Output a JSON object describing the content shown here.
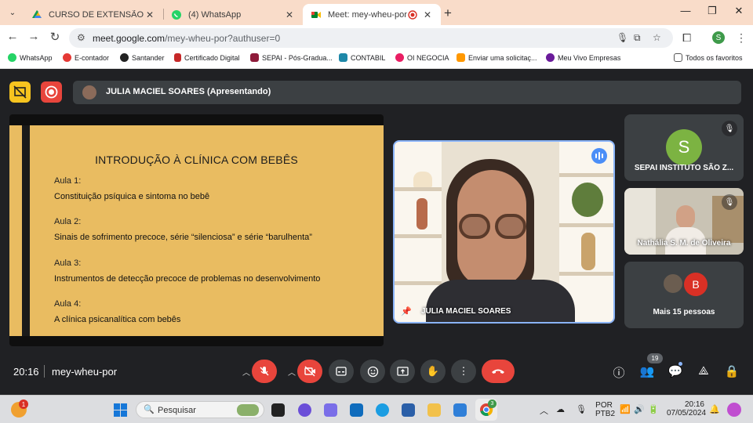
{
  "browser": {
    "tabs": [
      {
        "title": "CURSO DE EXTENSÃO INTRODU",
        "active": false
      },
      {
        "title": "(4) WhatsApp",
        "active": false
      },
      {
        "title": "Meet: mey-wheu-por",
        "active": true
      }
    ],
    "url_host": "meet.google.com",
    "url_path": "/mey-wheu-por?authuser=0",
    "profile_initial": "S",
    "bookmarks": [
      "WhatsApp",
      "E-contador",
      "Santander",
      "Certificado Digital",
      "SEPAI - Pós-Gradua...",
      "CONTABIL",
      "OI NEGOCIA",
      "Enviar uma solicitaç...",
      "Meu Vivo Empresas"
    ],
    "all_bookmarks": "Todos os favoritos"
  },
  "meet": {
    "presenter_bar": "JULIA MACIEL SOARES (Apresentando)",
    "slide": {
      "title": "INTRODUÇÃO À CLÍNICA COM BEBÊS",
      "lessons": [
        {
          "label": "Aula 1:",
          "text": "Constituição psíquica e sintoma no bebê"
        },
        {
          "label": "Aula 2:",
          "text": "Sinais de sofrimento precoce, série “silenciosa” e série “barulhenta”"
        },
        {
          "label": "Aula 3:",
          "text": "Instrumentos de detecção precoce de problemas no desenvolvimento"
        },
        {
          "label": "Aula 4:",
          "text": "A clínica psicanalítica com bebês"
        }
      ]
    },
    "main_speaker": "JULIA MACIEL SOARES",
    "tiles": {
      "tile1_name": "SEPAI INSTITUTO SÃO Z...",
      "tile1_initial": "S",
      "tile2_name": "Nathália S. M. de Oliveira",
      "tile3_initial": "B",
      "tile3_text": "Mais 15 pessoas"
    },
    "time": "20:16",
    "meeting_code": "mey-wheu-por",
    "participants_count": "19"
  },
  "taskbar": {
    "search_placeholder": "Pesquisar",
    "notif_badge": "1",
    "lang_line1": "POR",
    "lang_line2": "PTB2",
    "clock_time": "20:16",
    "clock_date": "07/05/2024",
    "chrome_badge": "3"
  },
  "colors": {
    "meet_bg": "#202124",
    "slide_yellow": "#e9bc61",
    "end_call_red": "#e8453c",
    "active_speaker_blue": "#8ab4f8",
    "tabstrip": "#f9dcc9"
  }
}
